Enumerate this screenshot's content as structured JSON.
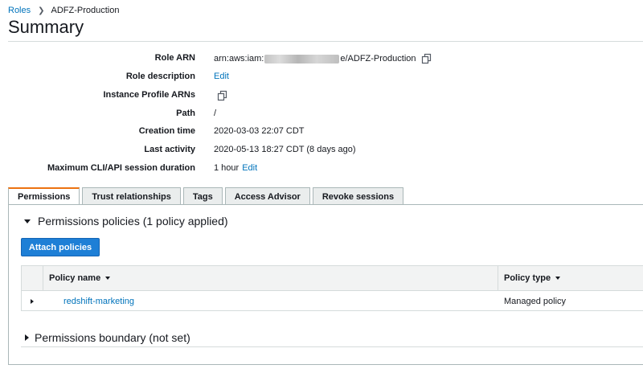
{
  "breadcrumb": {
    "parent": "Roles",
    "current": "ADFZ-Production"
  },
  "page": {
    "title": "Summary"
  },
  "summary": {
    "role_arn_label": "Role ARN",
    "role_arn_prefix": "arn:aws:iam:",
    "role_arn_suffix": "e/ADFZ-Production",
    "role_description_label": "Role description",
    "role_description_edit": "Edit",
    "instance_profile_label": "Instance Profile ARNs",
    "path_label": "Path",
    "path_value": "/",
    "creation_time_label": "Creation time",
    "creation_time_value": "2020-03-03 22:07 CDT",
    "last_activity_label": "Last activity",
    "last_activity_value": "2020-05-13 18:27 CDT (8 days ago)",
    "max_session_label": "Maximum CLI/API session duration",
    "max_session_value": "1 hour",
    "max_session_edit": "Edit"
  },
  "tabs": [
    {
      "label": "Permissions",
      "active": true
    },
    {
      "label": "Trust relationships",
      "active": false
    },
    {
      "label": "Tags",
      "active": false
    },
    {
      "label": "Access Advisor",
      "active": false
    },
    {
      "label": "Revoke sessions",
      "active": false
    }
  ],
  "permissions": {
    "policies_header": "Permissions policies (1 policy applied)",
    "attach_button": "Attach policies",
    "table": {
      "headers": [
        "Policy name",
        "Policy type"
      ],
      "rows": [
        {
          "name": "redshift-marketing",
          "type": "Managed policy"
        }
      ]
    },
    "boundary_header": "Permissions boundary (not set)"
  },
  "icons": {
    "copy": "copy-icon",
    "sort": "sort-caret-icon",
    "expand": "caret-right-icon",
    "collapse": "caret-down-icon"
  },
  "colors": {
    "link": "#0073bb",
    "primary_button": "#1e7fd6",
    "active_tab_accent": "#ec7211"
  }
}
